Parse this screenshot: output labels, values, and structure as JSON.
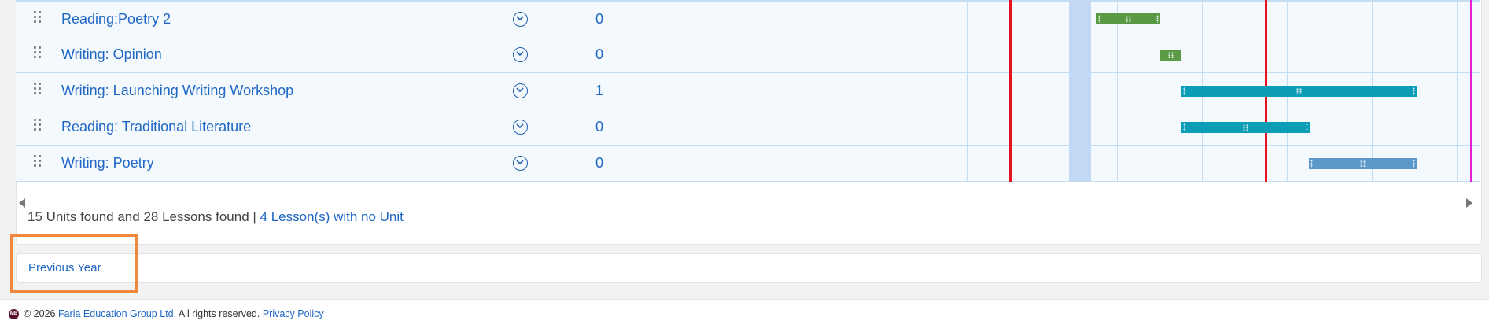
{
  "units": [
    {
      "title": "Reading:Poetry 2",
      "count": "0",
      "bar_color": "#5a9a44"
    },
    {
      "title": "Writing: Opinion",
      "count": "0",
      "bar_color": "#5a9a44"
    },
    {
      "title": "Writing: Launching Writing Workshop",
      "count": "1",
      "bar_color": "#0b9db5"
    },
    {
      "title": "Reading: Traditional Literature",
      "count": "0",
      "bar_color": "#0b9db5"
    },
    {
      "title": "Writing: Poetry",
      "count": "0",
      "bar_color": "#5b97c9"
    }
  ],
  "summary": {
    "text": "15 Units found and 28 Lessons found | ",
    "link": "4 Lesson(s) with no Unit"
  },
  "pager": {
    "previous_label": "Previous Year"
  },
  "footer": {
    "copyright": "© 2026 ",
    "company": "Faria Education Group Ltd.",
    "rights": " All rights reserved. ",
    "privacy": "Privacy Policy"
  },
  "colors": {
    "link": "#1f67c5",
    "today_line": "#e4131f",
    "end_line": "#e11fd8",
    "highlight": "#f0883e"
  }
}
